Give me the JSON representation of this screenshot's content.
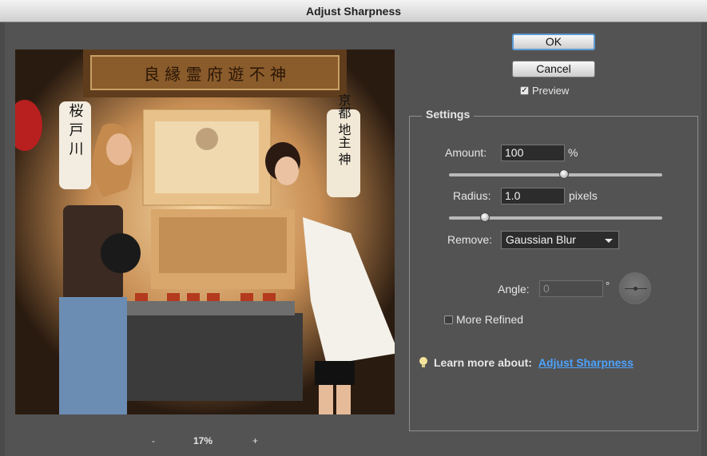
{
  "window": {
    "title": "Adjust Sharpness"
  },
  "buttons": {
    "ok": "OK",
    "cancel": "Cancel"
  },
  "preview_toggle": {
    "label": "Preview",
    "checked": true
  },
  "zoom": {
    "minus": "-",
    "plus": "+",
    "level": "17%"
  },
  "settings": {
    "legend": "Settings",
    "amount": {
      "label": "Amount:",
      "value": "100",
      "unit": "%",
      "slider_fraction": 0.54
    },
    "radius": {
      "label": "Radius:",
      "value": "1.0",
      "unit": "pixels",
      "slider_fraction": 0.17
    },
    "remove": {
      "label": "Remove:",
      "selected": "Gaussian Blur"
    },
    "angle": {
      "label": "Angle:",
      "value": "0",
      "unit": "°"
    },
    "more_refined": {
      "label": "More Refined",
      "checked": false
    }
  },
  "learn_more": {
    "prefix": "Learn more about:",
    "link": "Adjust Sharpness"
  },
  "photo": {
    "sign_text": "良 縁 霊 府 遊 不 神",
    "lantern_left": "桜 戸 川",
    "lantern_right": "京都 地主 神"
  }
}
